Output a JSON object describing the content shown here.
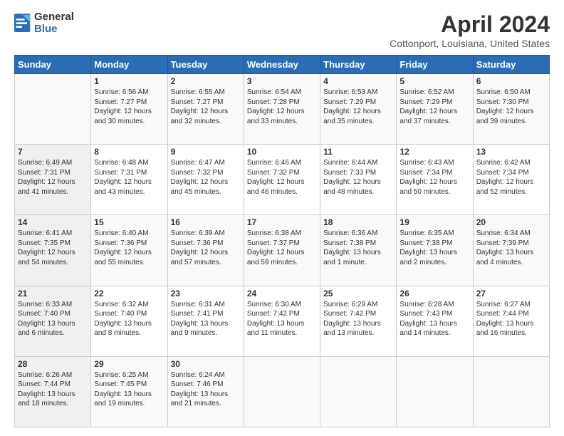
{
  "logo": {
    "general": "General",
    "blue": "Blue"
  },
  "title": "April 2024",
  "subtitle": "Cottonport, Louisiana, United States",
  "headers": [
    "Sunday",
    "Monday",
    "Tuesday",
    "Wednesday",
    "Thursday",
    "Friday",
    "Saturday"
  ],
  "weeks": [
    [
      {
        "day": "",
        "sunrise": "",
        "sunset": "",
        "daylight": ""
      },
      {
        "day": "1",
        "sunrise": "6:56 AM",
        "sunset": "7:27 PM",
        "daylight": "12 hours and 30 minutes."
      },
      {
        "day": "2",
        "sunrise": "6:55 AM",
        "sunset": "7:27 PM",
        "daylight": "12 hours and 32 minutes."
      },
      {
        "day": "3",
        "sunrise": "6:54 AM",
        "sunset": "7:28 PM",
        "daylight": "12 hours and 33 minutes."
      },
      {
        "day": "4",
        "sunrise": "6:53 AM",
        "sunset": "7:29 PM",
        "daylight": "12 hours and 35 minutes."
      },
      {
        "day": "5",
        "sunrise": "6:52 AM",
        "sunset": "7:29 PM",
        "daylight": "12 hours and 37 minutes."
      },
      {
        "day": "6",
        "sunrise": "6:50 AM",
        "sunset": "7:30 PM",
        "daylight": "12 hours and 39 minutes."
      }
    ],
    [
      {
        "day": "7",
        "sunrise": "6:49 AM",
        "sunset": "7:31 PM",
        "daylight": "12 hours and 41 minutes."
      },
      {
        "day": "8",
        "sunrise": "6:48 AM",
        "sunset": "7:31 PM",
        "daylight": "12 hours and 43 minutes."
      },
      {
        "day": "9",
        "sunrise": "6:47 AM",
        "sunset": "7:32 PM",
        "daylight": "12 hours and 45 minutes."
      },
      {
        "day": "10",
        "sunrise": "6:46 AM",
        "sunset": "7:32 PM",
        "daylight": "12 hours and 46 minutes."
      },
      {
        "day": "11",
        "sunrise": "6:44 AM",
        "sunset": "7:33 PM",
        "daylight": "12 hours and 48 minutes."
      },
      {
        "day": "12",
        "sunrise": "6:43 AM",
        "sunset": "7:34 PM",
        "daylight": "12 hours and 50 minutes."
      },
      {
        "day": "13",
        "sunrise": "6:42 AM",
        "sunset": "7:34 PM",
        "daylight": "12 hours and 52 minutes."
      }
    ],
    [
      {
        "day": "14",
        "sunrise": "6:41 AM",
        "sunset": "7:35 PM",
        "daylight": "12 hours and 54 minutes."
      },
      {
        "day": "15",
        "sunrise": "6:40 AM",
        "sunset": "7:36 PM",
        "daylight": "12 hours and 55 minutes."
      },
      {
        "day": "16",
        "sunrise": "6:39 AM",
        "sunset": "7:36 PM",
        "daylight": "12 hours and 57 minutes."
      },
      {
        "day": "17",
        "sunrise": "6:38 AM",
        "sunset": "7:37 PM",
        "daylight": "12 hours and 59 minutes."
      },
      {
        "day": "18",
        "sunrise": "6:36 AM",
        "sunset": "7:38 PM",
        "daylight": "13 hours and 1 minute."
      },
      {
        "day": "19",
        "sunrise": "6:35 AM",
        "sunset": "7:38 PM",
        "daylight": "13 hours and 2 minutes."
      },
      {
        "day": "20",
        "sunrise": "6:34 AM",
        "sunset": "7:39 PM",
        "daylight": "13 hours and 4 minutes."
      }
    ],
    [
      {
        "day": "21",
        "sunrise": "6:33 AM",
        "sunset": "7:40 PM",
        "daylight": "13 hours and 6 minutes."
      },
      {
        "day": "22",
        "sunrise": "6:32 AM",
        "sunset": "7:40 PM",
        "daylight": "13 hours and 8 minutes."
      },
      {
        "day": "23",
        "sunrise": "6:31 AM",
        "sunset": "7:41 PM",
        "daylight": "13 hours and 9 minutes."
      },
      {
        "day": "24",
        "sunrise": "6:30 AM",
        "sunset": "7:42 PM",
        "daylight": "13 hours and 11 minutes."
      },
      {
        "day": "25",
        "sunrise": "6:29 AM",
        "sunset": "7:42 PM",
        "daylight": "13 hours and 13 minutes."
      },
      {
        "day": "26",
        "sunrise": "6:28 AM",
        "sunset": "7:43 PM",
        "daylight": "13 hours and 14 minutes."
      },
      {
        "day": "27",
        "sunrise": "6:27 AM",
        "sunset": "7:44 PM",
        "daylight": "13 hours and 16 minutes."
      }
    ],
    [
      {
        "day": "28",
        "sunrise": "6:26 AM",
        "sunset": "7:44 PM",
        "daylight": "13 hours and 18 minutes."
      },
      {
        "day": "29",
        "sunrise": "6:25 AM",
        "sunset": "7:45 PM",
        "daylight": "13 hours and 19 minutes."
      },
      {
        "day": "30",
        "sunrise": "6:24 AM",
        "sunset": "7:46 PM",
        "daylight": "13 hours and 21 minutes."
      },
      {
        "day": "",
        "sunrise": "",
        "sunset": "",
        "daylight": ""
      },
      {
        "day": "",
        "sunrise": "",
        "sunset": "",
        "daylight": ""
      },
      {
        "day": "",
        "sunrise": "",
        "sunset": "",
        "daylight": ""
      },
      {
        "day": "",
        "sunrise": "",
        "sunset": "",
        "daylight": ""
      }
    ]
  ]
}
